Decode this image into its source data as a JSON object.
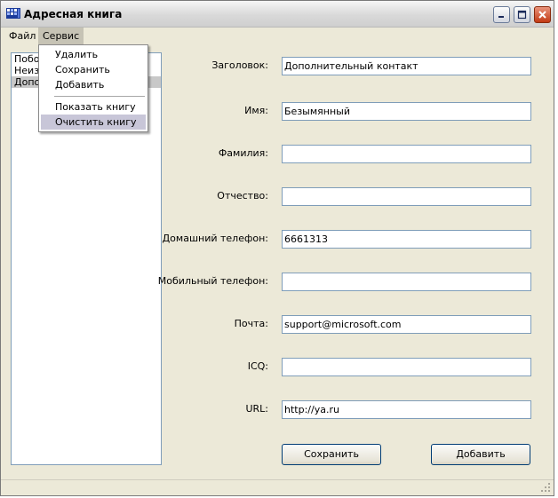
{
  "window": {
    "title": "Адресная книга"
  },
  "menubar": {
    "items": [
      "Файл",
      "Сервис"
    ]
  },
  "dropdown": {
    "items": [
      "Удалить",
      "Сохранить",
      "Добавить",
      "Показать книгу",
      "Очистить книгу"
    ],
    "highlighted": "Очистить книгу"
  },
  "contacts": {
    "items": [
      "Побоч",
      "Неизв",
      "Допо"
    ],
    "selected_index": 2
  },
  "form": {
    "fields": [
      {
        "label": "Заголовок:",
        "value": "Дополнительный контакт"
      },
      {
        "label": "Имя:",
        "value": "Безымянный"
      },
      {
        "label": "Фамилия:",
        "value": ""
      },
      {
        "label": "Отчество:",
        "value": ""
      },
      {
        "label": "Домашний телефон:",
        "value": "6661313"
      },
      {
        "label": "Мобильный телефон:",
        "value": ""
      },
      {
        "label": "Почта:",
        "value": "support@microsoft.com"
      },
      {
        "label": "ICQ:",
        "value": ""
      },
      {
        "label": "URL:",
        "value": "http://ya.ru"
      }
    ]
  },
  "buttons": {
    "save": "Сохранить",
    "add": "Добавить"
  },
  "icons": {
    "app": "address-book-icon",
    "minimize": "minimize-icon",
    "maximize": "maximize-icon",
    "close": "close-icon",
    "grip": "resize-grip-icon"
  },
  "colors": {
    "window_bg": "#ece9d8",
    "input_border": "#7f9db9",
    "button_border": "#003c74",
    "close_button": "#c23a14",
    "menu_highlight": "#c8c6d8"
  }
}
